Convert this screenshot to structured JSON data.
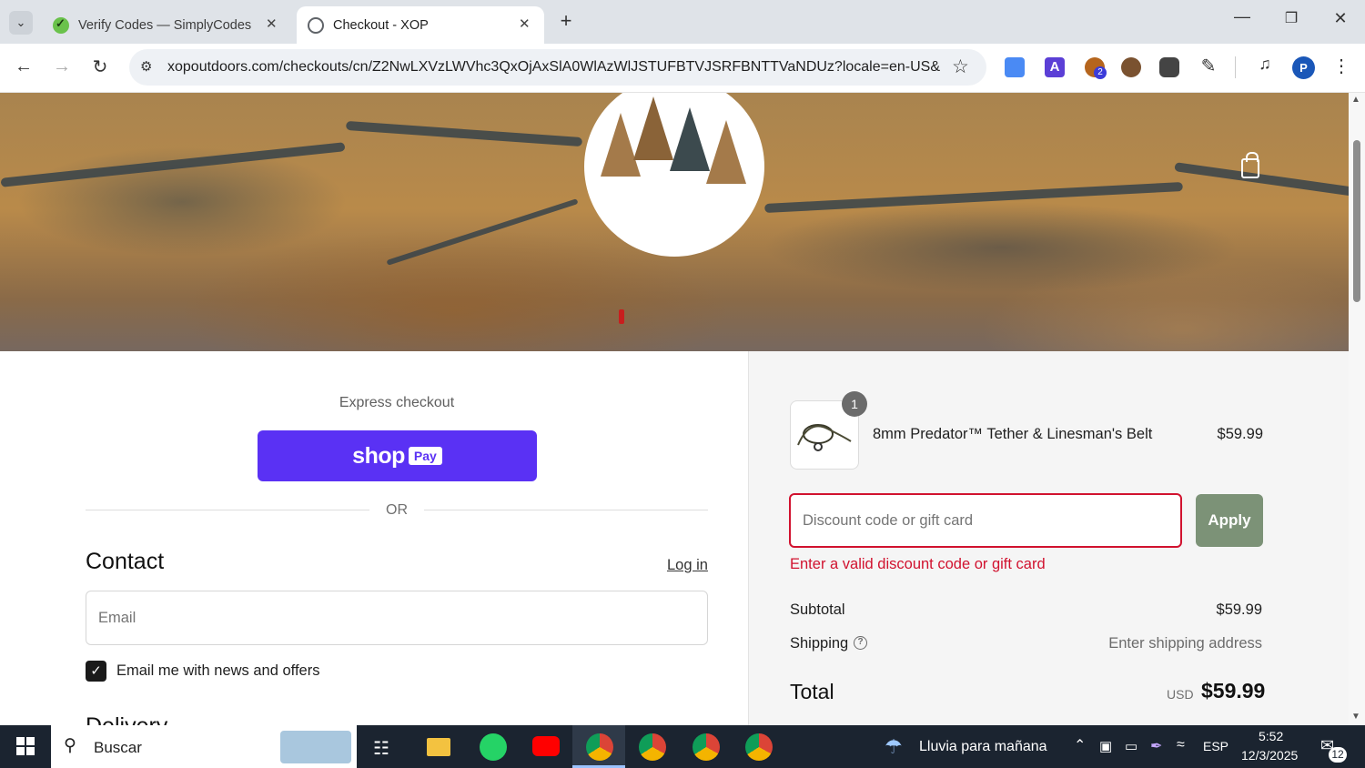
{
  "browser": {
    "tabs": [
      {
        "title": "Verify Codes — SimplyCodes",
        "active": false
      },
      {
        "title": "Checkout - XOP",
        "active": true
      }
    ],
    "url": "xopoutdoors.com/checkouts/cn/Z2NwLXVzLWVhc3QxOjAxSlA0WlAzWlJSTUFBTVJSRFBNTTVaNDUz?locale=en-US&...",
    "profile_initial": "P",
    "extension_badge": "2"
  },
  "checkout": {
    "express_checkout_label": "Express checkout",
    "shop_pay": {
      "shop": "shop",
      "pay": "Pay"
    },
    "or_label": "OR",
    "contact": {
      "heading": "Contact",
      "login_link": "Log in",
      "email_placeholder": "Email",
      "news_opt_in_label": "Email me with news and offers",
      "news_opt_in_checked": true
    },
    "delivery_heading": "Delivery"
  },
  "order_summary": {
    "item": {
      "name": "8mm Predator™ Tether & Linesman's Belt",
      "price": "$59.99",
      "quantity": "1"
    },
    "discount": {
      "placeholder": "Discount code or gift card",
      "apply_label": "Apply",
      "error": "Enter a valid discount code or gift card"
    },
    "subtotal_label": "Subtotal",
    "subtotal_value": "$59.99",
    "shipping_label": "Shipping",
    "shipping_value": "Enter shipping address",
    "total_label": "Total",
    "total_currency": "USD",
    "total_value": "$59.99"
  },
  "taskbar": {
    "search_placeholder": "Buscar",
    "weather": "Lluvia para mañana",
    "language": "ESP",
    "time": "5:52",
    "date": "12/3/2025",
    "notifications": "12"
  },
  "colors": {
    "shop_pay": "#5a31f4",
    "error": "#d1122f",
    "apply_button": "#7c9277"
  }
}
